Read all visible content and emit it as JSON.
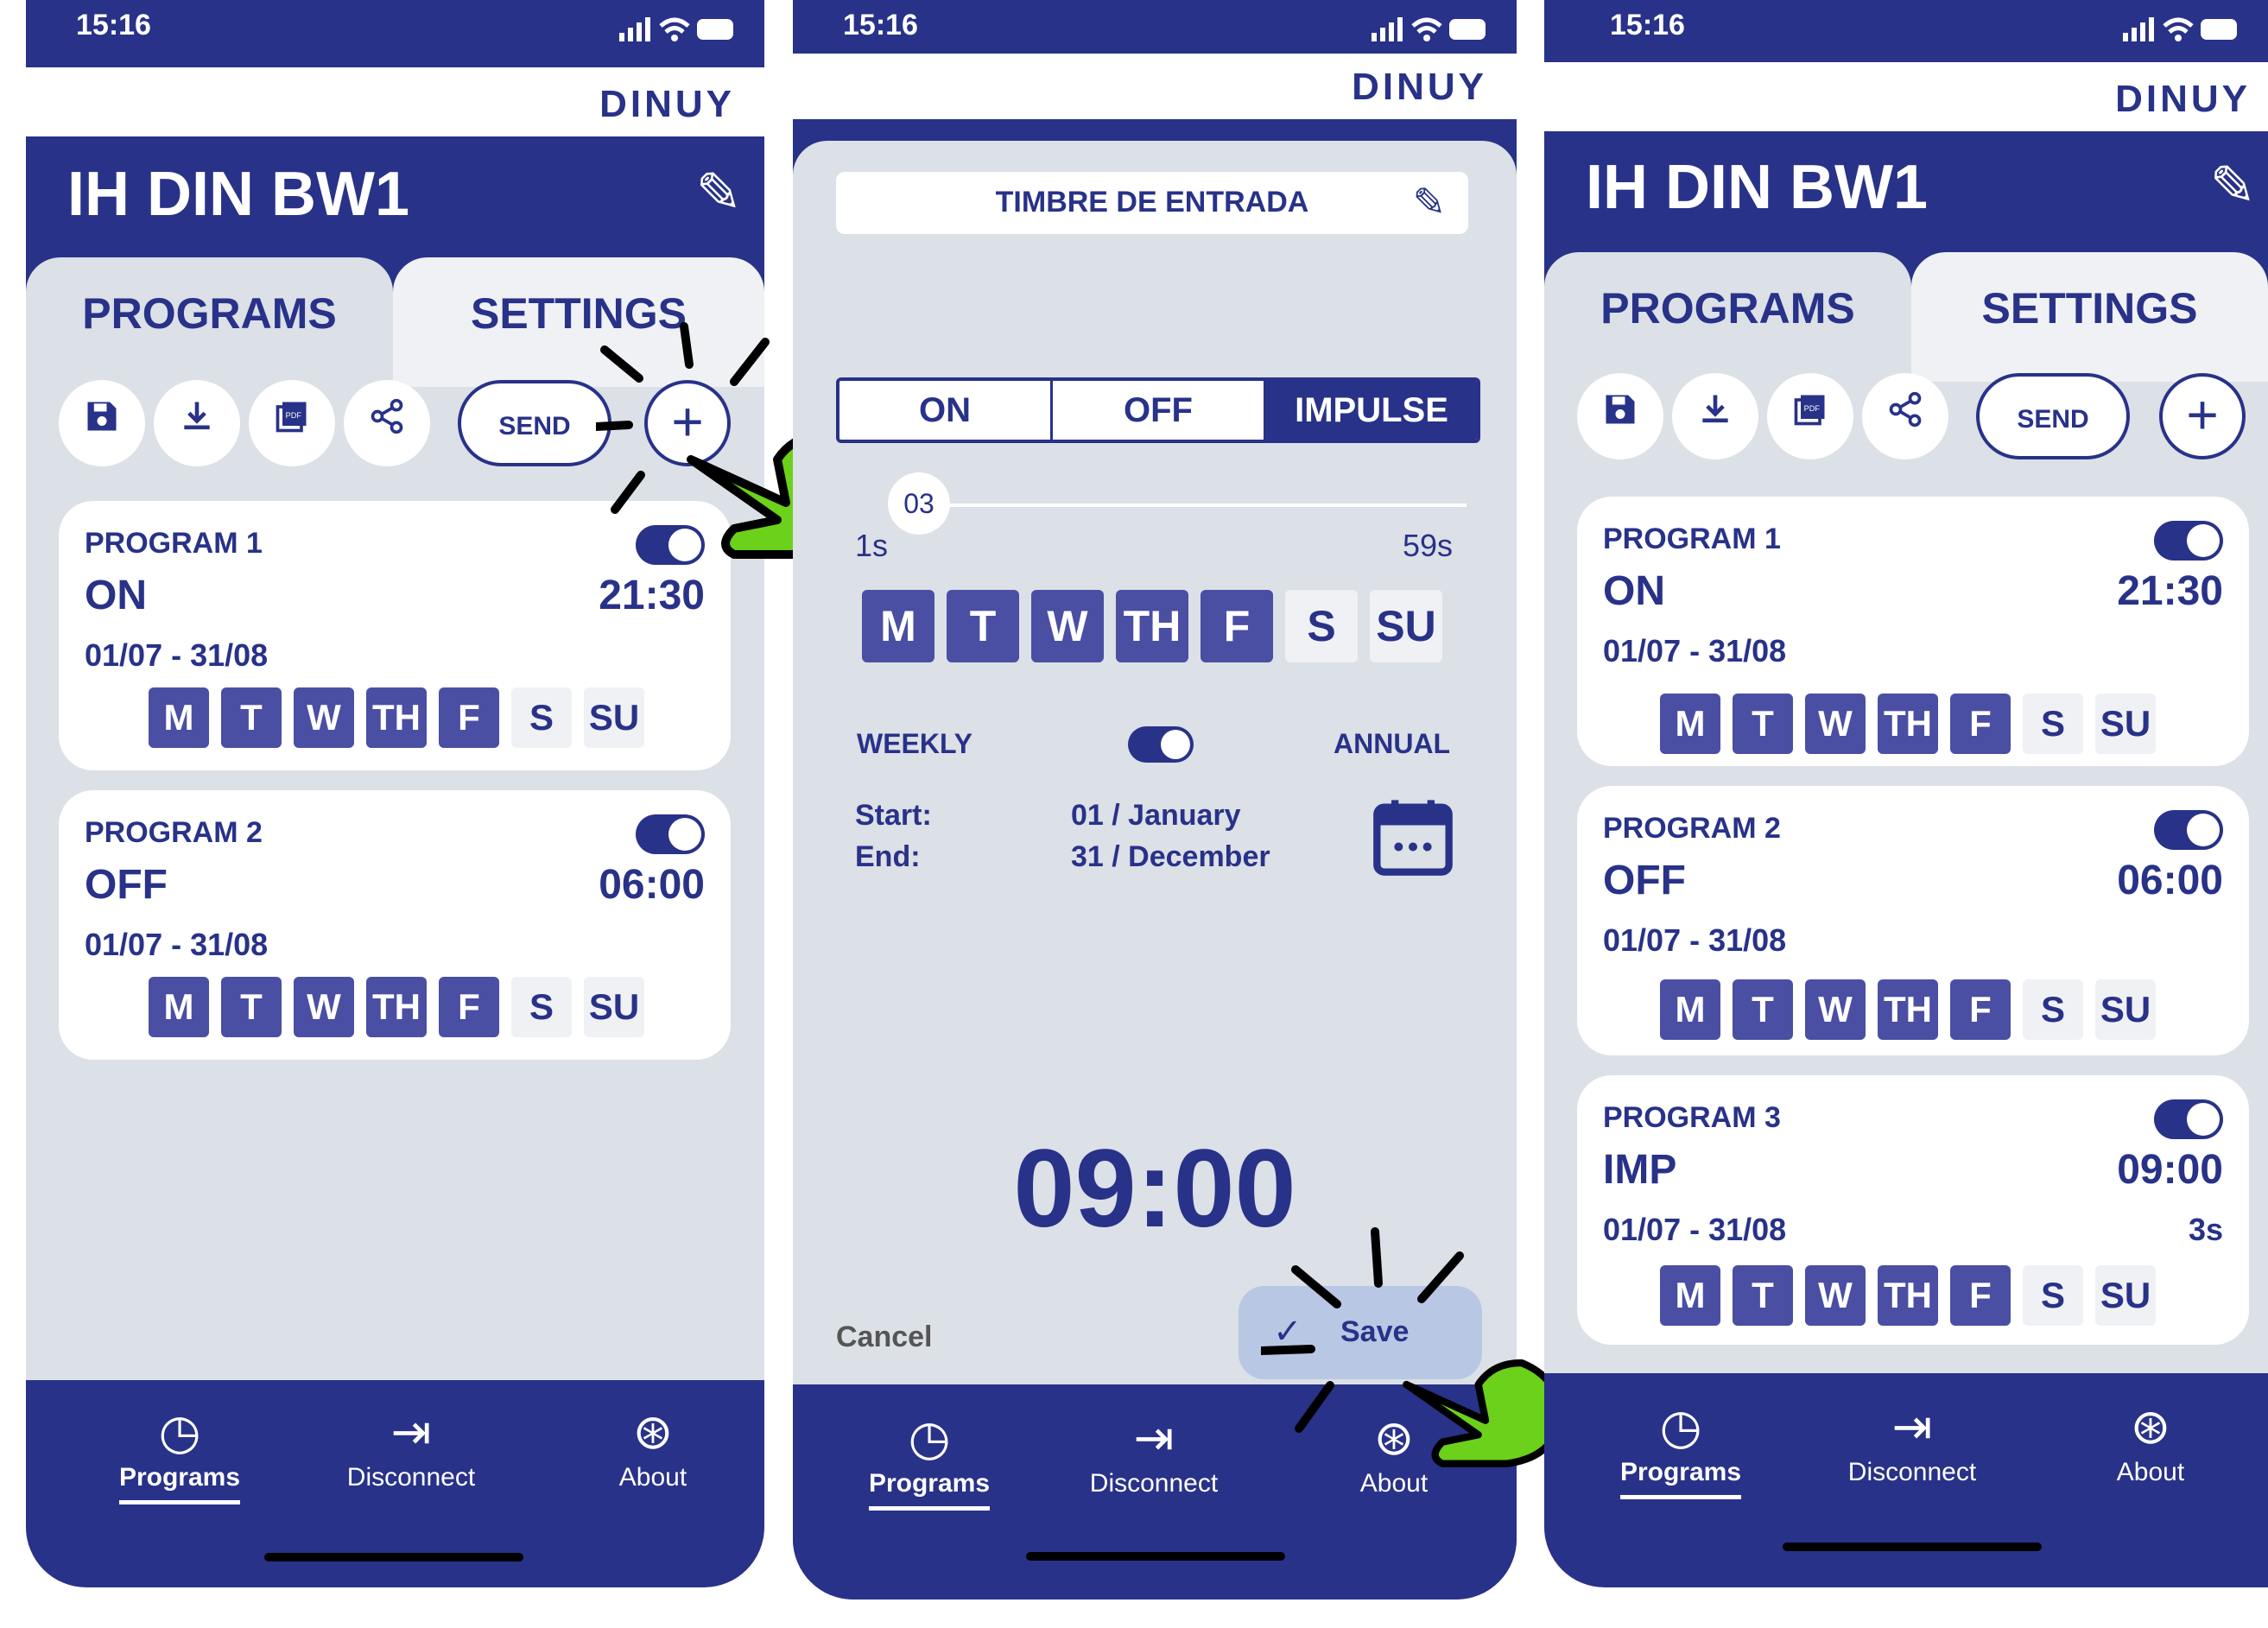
{
  "screen1": {
    "status": {
      "time": "15:16"
    },
    "logo": "DINUY",
    "device_title": "IH DIN BW1",
    "tabs": {
      "programs": "PROGRAMS",
      "settings": "SETTINGS"
    },
    "send_label": "SEND",
    "programs": [
      {
        "name": "PROGRAM 1",
        "mode": "ON",
        "time": "21:30",
        "dates": "01/07 - 31/08",
        "days": [
          "M",
          "T",
          "W",
          "TH",
          "F",
          "S",
          "SU"
        ]
      },
      {
        "name": "PROGRAM 2",
        "mode": "OFF",
        "time": "06:00",
        "dates": "01/07 - 31/08",
        "days": [
          "M",
          "T",
          "W",
          "TH",
          "F",
          "S",
          "SU"
        ]
      }
    ],
    "nav": {
      "programs": "Programs",
      "disconnect": "Disconnect",
      "about": "About"
    }
  },
  "screen2": {
    "status": {
      "time": "15:16"
    },
    "logo": "DINUY",
    "program_name": "TIMBRE DE ENTRADA",
    "modes": [
      "ON",
      "OFF",
      "IMPULSE"
    ],
    "selected_mode": "IMPULSE",
    "slider": {
      "value": "03",
      "min_label": "1s",
      "max_label": "59s"
    },
    "days": [
      "M",
      "T",
      "W",
      "TH",
      "F",
      "S",
      "SU"
    ],
    "weekly_label": "WEEKLY",
    "annual_label": "ANNUAL",
    "start_label": "Start:",
    "start_value": "01 / January",
    "end_label": "End:",
    "end_value": "31 / December",
    "time": "09:00",
    "cancel_label": "Cancel",
    "save_label": "Save",
    "nav": {
      "programs": "Programs",
      "disconnect": "Disconnect",
      "about": "About"
    }
  },
  "screen3": {
    "status": {
      "time": "15:16"
    },
    "logo": "DINUY",
    "device_title": "IH DIN BW1",
    "tabs": {
      "programs": "PROGRAMS",
      "settings": "SETTINGS"
    },
    "send_label": "SEND",
    "programs": [
      {
        "name": "PROGRAM 1",
        "mode": "ON",
        "time": "21:30",
        "dates": "01/07 - 31/08",
        "days": [
          "M",
          "T",
          "W",
          "TH",
          "F",
          "S",
          "SU"
        ]
      },
      {
        "name": "PROGRAM 2",
        "mode": "OFF",
        "time": "06:00",
        "dates": "01/07 - 31/08",
        "days": [
          "M",
          "T",
          "W",
          "TH",
          "F",
          "S",
          "SU"
        ]
      },
      {
        "name": "PROGRAM 3",
        "mode": "IMP",
        "time": "09:00",
        "dates": "01/07 - 31/08",
        "duration": "3s",
        "days": [
          "M",
          "T",
          "W",
          "TH",
          "F",
          "S",
          "SU"
        ]
      }
    ],
    "nav": {
      "programs": "Programs",
      "disconnect": "Disconnect",
      "about": "About"
    }
  },
  "colors": {
    "primary": "#283288",
    "day_active": "#4a4fa3",
    "day_inactive": "#eff1f4",
    "background": "#dce0e7",
    "highlight": "#6bd11a"
  },
  "icons": [
    "save-icon",
    "download-icon",
    "pdf-icon",
    "share-icon",
    "plus-icon",
    "pencil-icon",
    "clock-icon",
    "logout-icon",
    "lifebuoy-icon",
    "calendar-icon",
    "check-icon",
    "pointing-hand-icon"
  ]
}
